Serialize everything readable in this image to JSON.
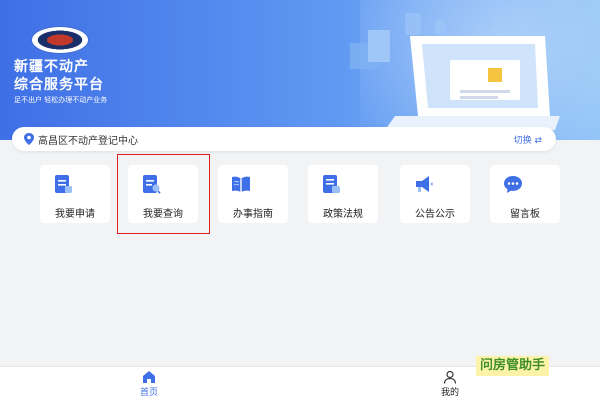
{
  "header": {
    "title_line1": "新疆不动产",
    "title_line2": "综合服务平台",
    "slogan": "足不出户 轻松办理不动产业务"
  },
  "location": {
    "name": "高昌区不动产登记中心",
    "switch_label": "切换 ⇄"
  },
  "menu": [
    {
      "label": "我要申请",
      "icon": "application-doc-icon"
    },
    {
      "label": "我要查询",
      "icon": "search-doc-icon"
    },
    {
      "label": "办事指南",
      "icon": "guide-book-icon"
    },
    {
      "label": "政策法规",
      "icon": "policy-doc-icon"
    },
    {
      "label": "公告公示",
      "icon": "megaphone-icon"
    },
    {
      "label": "留言板",
      "icon": "chat-bubble-icon"
    }
  ],
  "tabbar": [
    {
      "label": "首页",
      "icon": "home-icon",
      "active": true
    },
    {
      "label": "我的",
      "icon": "user-icon",
      "active": false
    }
  ],
  "watermark": "问房管助手",
  "colors": {
    "primary": "#3f6fe6",
    "highlight": "#e02020",
    "text": "#222222"
  }
}
